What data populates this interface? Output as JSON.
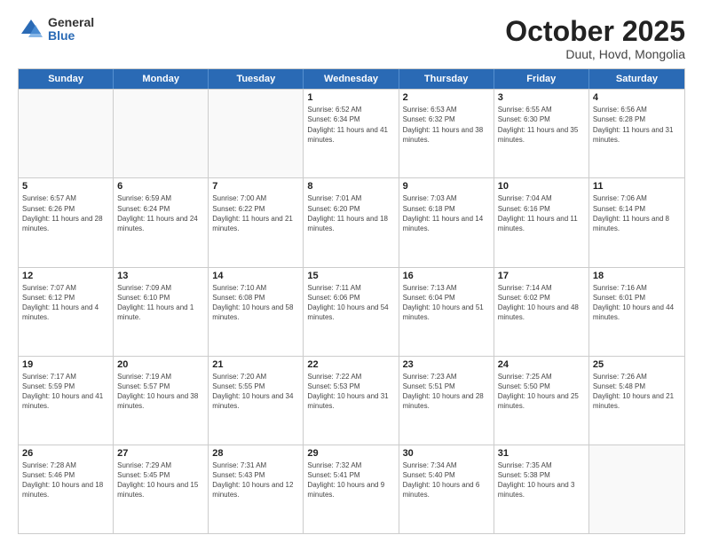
{
  "logo": {
    "general": "General",
    "blue": "Blue"
  },
  "header": {
    "month": "October 2025",
    "location": "Duut, Hovd, Mongolia"
  },
  "days_of_week": [
    "Sunday",
    "Monday",
    "Tuesday",
    "Wednesday",
    "Thursday",
    "Friday",
    "Saturday"
  ],
  "weeks": [
    [
      {
        "day": "",
        "empty": true
      },
      {
        "day": "",
        "empty": true
      },
      {
        "day": "",
        "empty": true
      },
      {
        "day": "1",
        "sunrise": "6:52 AM",
        "sunset": "6:34 PM",
        "daylight": "11 hours and 41 minutes."
      },
      {
        "day": "2",
        "sunrise": "6:53 AM",
        "sunset": "6:32 PM",
        "daylight": "11 hours and 38 minutes."
      },
      {
        "day": "3",
        "sunrise": "6:55 AM",
        "sunset": "6:30 PM",
        "daylight": "11 hours and 35 minutes."
      },
      {
        "day": "4",
        "sunrise": "6:56 AM",
        "sunset": "6:28 PM",
        "daylight": "11 hours and 31 minutes."
      }
    ],
    [
      {
        "day": "5",
        "sunrise": "6:57 AM",
        "sunset": "6:26 PM",
        "daylight": "11 hours and 28 minutes."
      },
      {
        "day": "6",
        "sunrise": "6:59 AM",
        "sunset": "6:24 PM",
        "daylight": "11 hours and 24 minutes."
      },
      {
        "day": "7",
        "sunrise": "7:00 AM",
        "sunset": "6:22 PM",
        "daylight": "11 hours and 21 minutes."
      },
      {
        "day": "8",
        "sunrise": "7:01 AM",
        "sunset": "6:20 PM",
        "daylight": "11 hours and 18 minutes."
      },
      {
        "day": "9",
        "sunrise": "7:03 AM",
        "sunset": "6:18 PM",
        "daylight": "11 hours and 14 minutes."
      },
      {
        "day": "10",
        "sunrise": "7:04 AM",
        "sunset": "6:16 PM",
        "daylight": "11 hours and 11 minutes."
      },
      {
        "day": "11",
        "sunrise": "7:06 AM",
        "sunset": "6:14 PM",
        "daylight": "11 hours and 8 minutes."
      }
    ],
    [
      {
        "day": "12",
        "sunrise": "7:07 AM",
        "sunset": "6:12 PM",
        "daylight": "11 hours and 4 minutes."
      },
      {
        "day": "13",
        "sunrise": "7:09 AM",
        "sunset": "6:10 PM",
        "daylight": "11 hours and 1 minute."
      },
      {
        "day": "14",
        "sunrise": "7:10 AM",
        "sunset": "6:08 PM",
        "daylight": "10 hours and 58 minutes."
      },
      {
        "day": "15",
        "sunrise": "7:11 AM",
        "sunset": "6:06 PM",
        "daylight": "10 hours and 54 minutes."
      },
      {
        "day": "16",
        "sunrise": "7:13 AM",
        "sunset": "6:04 PM",
        "daylight": "10 hours and 51 minutes."
      },
      {
        "day": "17",
        "sunrise": "7:14 AM",
        "sunset": "6:02 PM",
        "daylight": "10 hours and 48 minutes."
      },
      {
        "day": "18",
        "sunrise": "7:16 AM",
        "sunset": "6:01 PM",
        "daylight": "10 hours and 44 minutes."
      }
    ],
    [
      {
        "day": "19",
        "sunrise": "7:17 AM",
        "sunset": "5:59 PM",
        "daylight": "10 hours and 41 minutes."
      },
      {
        "day": "20",
        "sunrise": "7:19 AM",
        "sunset": "5:57 PM",
        "daylight": "10 hours and 38 minutes."
      },
      {
        "day": "21",
        "sunrise": "7:20 AM",
        "sunset": "5:55 PM",
        "daylight": "10 hours and 34 minutes."
      },
      {
        "day": "22",
        "sunrise": "7:22 AM",
        "sunset": "5:53 PM",
        "daylight": "10 hours and 31 minutes."
      },
      {
        "day": "23",
        "sunrise": "7:23 AM",
        "sunset": "5:51 PM",
        "daylight": "10 hours and 28 minutes."
      },
      {
        "day": "24",
        "sunrise": "7:25 AM",
        "sunset": "5:50 PM",
        "daylight": "10 hours and 25 minutes."
      },
      {
        "day": "25",
        "sunrise": "7:26 AM",
        "sunset": "5:48 PM",
        "daylight": "10 hours and 21 minutes."
      }
    ],
    [
      {
        "day": "26",
        "sunrise": "7:28 AM",
        "sunset": "5:46 PM",
        "daylight": "10 hours and 18 minutes."
      },
      {
        "day": "27",
        "sunrise": "7:29 AM",
        "sunset": "5:45 PM",
        "daylight": "10 hours and 15 minutes."
      },
      {
        "day": "28",
        "sunrise": "7:31 AM",
        "sunset": "5:43 PM",
        "daylight": "10 hours and 12 minutes."
      },
      {
        "day": "29",
        "sunrise": "7:32 AM",
        "sunset": "5:41 PM",
        "daylight": "10 hours and 9 minutes."
      },
      {
        "day": "30",
        "sunrise": "7:34 AM",
        "sunset": "5:40 PM",
        "daylight": "10 hours and 6 minutes."
      },
      {
        "day": "31",
        "sunrise": "7:35 AM",
        "sunset": "5:38 PM",
        "daylight": "10 hours and 3 minutes."
      },
      {
        "day": "",
        "empty": true
      }
    ]
  ]
}
